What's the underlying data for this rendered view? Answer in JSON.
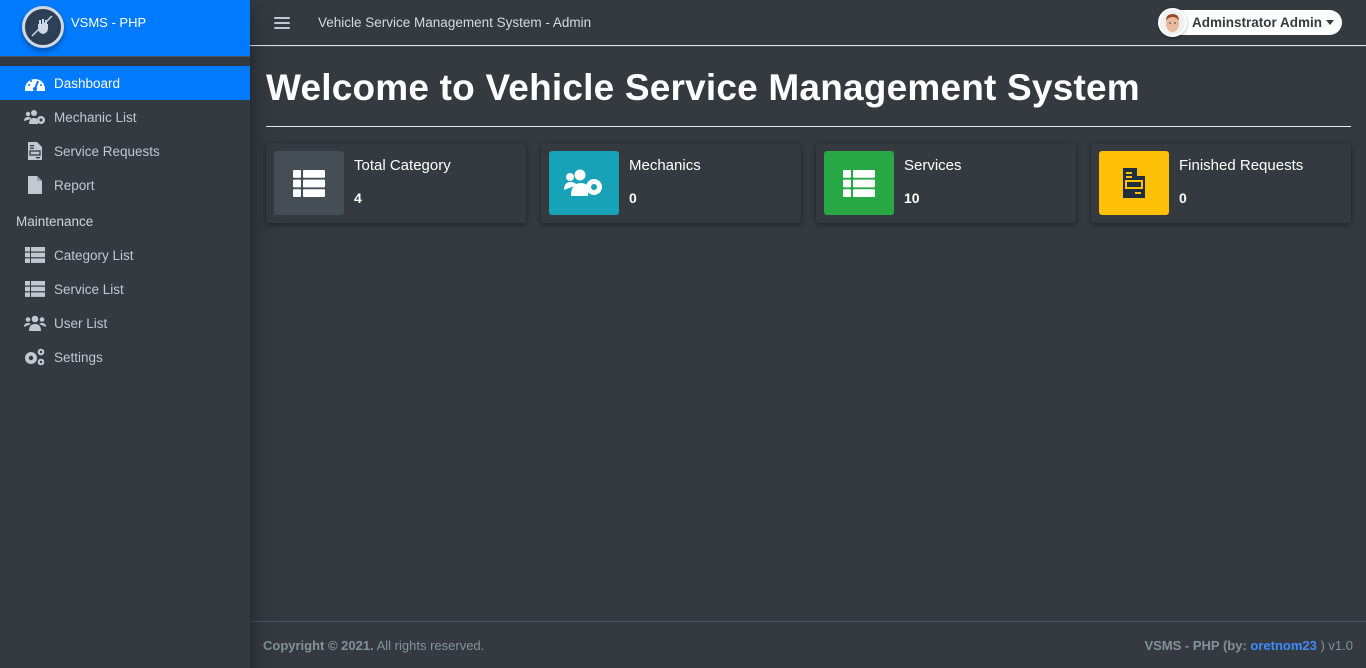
{
  "brand": {
    "name": "VSMS - PHP",
    "logo_icon": "raised-fist-wrench-logo"
  },
  "sidebar": {
    "items": [
      {
        "label": "Dashboard",
        "icon": "tachometer-icon",
        "active": true
      },
      {
        "label": "Mechanic List",
        "icon": "users-cog-icon"
      },
      {
        "label": "Service Requests",
        "icon": "file-invoice-icon"
      },
      {
        "label": "Report",
        "icon": "file-icon"
      }
    ],
    "section_header": "Maintenance",
    "maintenance_items": [
      {
        "label": "Category List",
        "icon": "th-list-icon"
      },
      {
        "label": "Service List",
        "icon": "th-list-icon"
      },
      {
        "label": "User List",
        "icon": "users-icon"
      },
      {
        "label": "Settings",
        "icon": "cogs-icon"
      }
    ]
  },
  "navbar": {
    "menu_icon": "bars-icon",
    "title": "Vehicle Service Management System - Admin",
    "user_name": "Adminstrator Admin"
  },
  "main": {
    "page_title": "Welcome to Vehicle Service Management System",
    "info_boxes": [
      {
        "label": "Total Category",
        "value": "4",
        "icon": "th-list-icon",
        "color": "#454d55"
      },
      {
        "label": "Mechanics",
        "value": "0",
        "icon": "users-cog-icon",
        "color": "#17a2b8"
      },
      {
        "label": "Services",
        "value": "10",
        "icon": "th-list-icon",
        "color": "#28a745"
      },
      {
        "label": "Finished Requests",
        "value": "0",
        "icon": "file-invoice-icon",
        "color": "#ffc107"
      }
    ]
  },
  "footer": {
    "copyright_bold": "Copyright © 2021.",
    "copyright_rest": " All rights reserved.",
    "credit_prefix": "VSMS - PHP (by: ",
    "credit_link": "oretnom23",
    "credit_suffix": " ) v1.0"
  },
  "colors": {
    "primary": "#007bff",
    "dark": "#343a40",
    "info": "#17a2b8",
    "success": "#28a745",
    "warning": "#ffc107"
  }
}
